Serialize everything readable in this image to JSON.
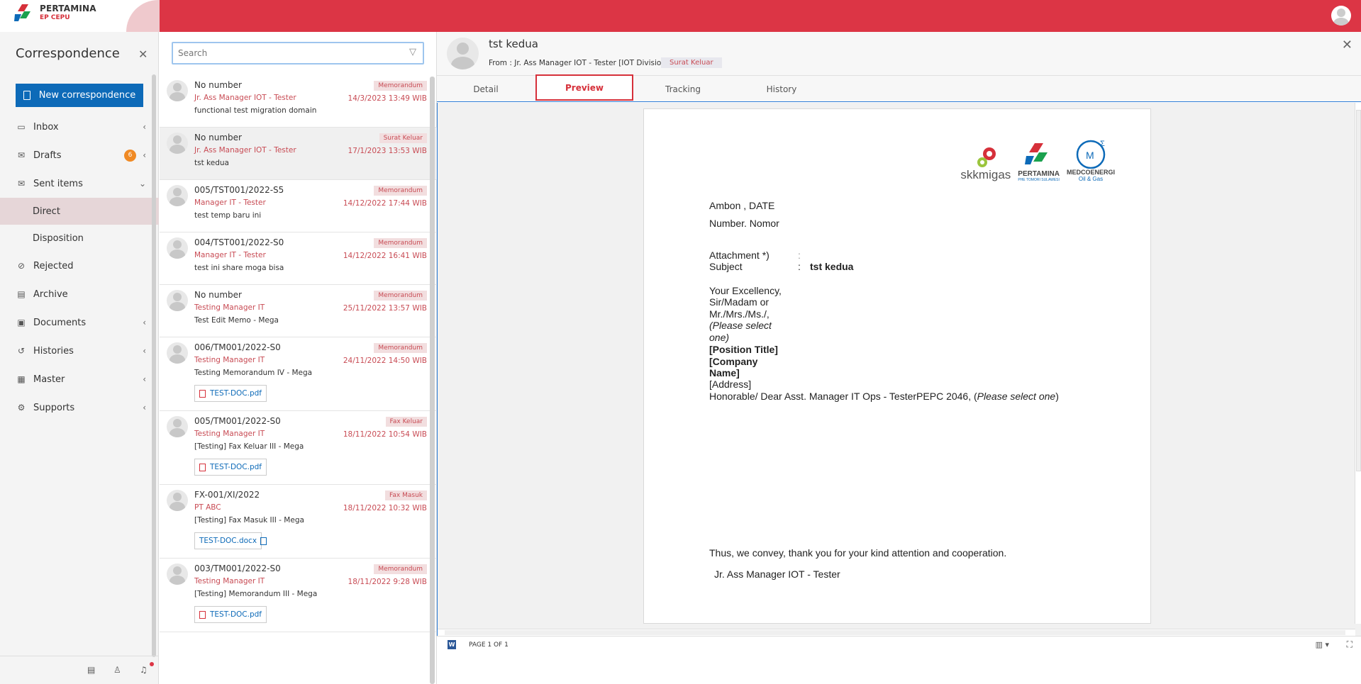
{
  "brand": {
    "name": "PERTAMINA",
    "sub": "EP CEPU"
  },
  "sidebar": {
    "title": "Correspondence",
    "new_button": "New correspondence",
    "items": [
      {
        "label": "Inbox"
      },
      {
        "label": "Drafts",
        "badge": "6"
      },
      {
        "label": "Sent items"
      },
      {
        "label": "Direct"
      },
      {
        "label": "Disposition"
      },
      {
        "label": "Rejected"
      },
      {
        "label": "Archive"
      },
      {
        "label": "Documents"
      },
      {
        "label": "Histories"
      },
      {
        "label": "Master"
      },
      {
        "label": "Supports"
      }
    ]
  },
  "search": {
    "placeholder": "Search"
  },
  "list": [
    {
      "number": "No number",
      "from": "Jr. Ass Manager IOT - Tester",
      "subject": "functional test migration domain",
      "type": "Memorandum",
      "date": "14/3/2023 13:49 WIB"
    },
    {
      "number": "No number",
      "from": "Jr. Ass Manager IOT - Tester",
      "subject": "tst kedua",
      "type": "Surat Keluar",
      "date": "17/1/2023 13:53 WIB"
    },
    {
      "number": "005/TST001/2022-S5",
      "from": "Manager IT - Tester",
      "subject": "test temp baru ini",
      "type": "Memorandum",
      "date": "14/12/2022 17:44 WIB"
    },
    {
      "number": "004/TST001/2022-S0",
      "from": "Manager IT - Tester",
      "subject": "test ini share moga bisa",
      "type": "Memorandum",
      "date": "14/12/2022 16:41 WIB"
    },
    {
      "number": "No number",
      "from": "Testing Manager IT",
      "subject": "Test Edit Memo - Mega",
      "type": "Memorandum",
      "date": "25/11/2022 13:57 WIB"
    },
    {
      "number": "006/TM001/2022-S0",
      "from": "Testing Manager IT",
      "subject": "Testing Memorandum IV - Mega",
      "type": "Memorandum",
      "date": "24/11/2022 14:50 WIB",
      "file": "TEST-DOC.pdf"
    },
    {
      "number": "005/TM001/2022-S0",
      "from": "Testing Manager IT",
      "subject": "[Testing] Fax Keluar III - Mega",
      "type": "Fax Keluar",
      "date": "18/11/2022 10:54 WIB",
      "file": "TEST-DOC.pdf"
    },
    {
      "number": "FX-001/XI/2022",
      "from": "PT ABC",
      "subject": "[Testing] Fax Masuk III - Mega",
      "type": "Fax Masuk",
      "date": "18/11/2022 10:32 WIB",
      "file": "TEST-DOC.docx"
    },
    {
      "number": "003/TM001/2022-S0",
      "from": "Testing Manager IT",
      "subject": "[Testing] Memorandum III - Mega",
      "type": "Memorandum",
      "date": "18/11/2022 9:28 WIB",
      "file": "TEST-DOC.pdf"
    }
  ],
  "detail": {
    "title": "tst kedua",
    "from": "From : Jr. Ass Manager IOT - Tester [IOT Divisiong]",
    "tag": "Surat Keluar",
    "tabs": [
      "Detail",
      "Preview",
      "Tracking",
      "History"
    ]
  },
  "document": {
    "logos": [
      "skkmigas",
      "PERTAMINA",
      "MEDCOENERGI"
    ],
    "logo_sub_pertamina": "PHE TOMORI SULAWESI",
    "logo_sub_medco": "Oil & Gas",
    "place_date": "Ambon , DATE",
    "number": "Number. Nomor",
    "attachment_label": "Attachment *)",
    "subject_label": "Subject",
    "colon": ":",
    "subject_value": "tst kedua",
    "salutation_1": "Your Excellency,",
    "salutation_2": "Sir/Madam or",
    "salutation_3": "Mr./Mrs./Ms./,",
    "salutation_4": "(Please select",
    "salutation_5": "one)",
    "position": "[Position Title]",
    "company_1": "[Company",
    "company_2": "Name]",
    "address": "[Address]",
    "honorable": "Honorable/ Dear Asst. Manager IT Ops - TesterPEPC 2046, (",
    "honorable_em": "Please select one",
    "honorable_end": ")",
    "closing": "Thus, we convey, thank you for your kind attention and cooperation.",
    "signer": "Jr. Ass Manager IOT - Tester"
  },
  "status": {
    "page": "PAGE 1 OF 1"
  },
  "colors": {
    "primary_red": "#dc3545",
    "button_blue": "#0d6ab8",
    "badge_orange": "#f08a24"
  }
}
